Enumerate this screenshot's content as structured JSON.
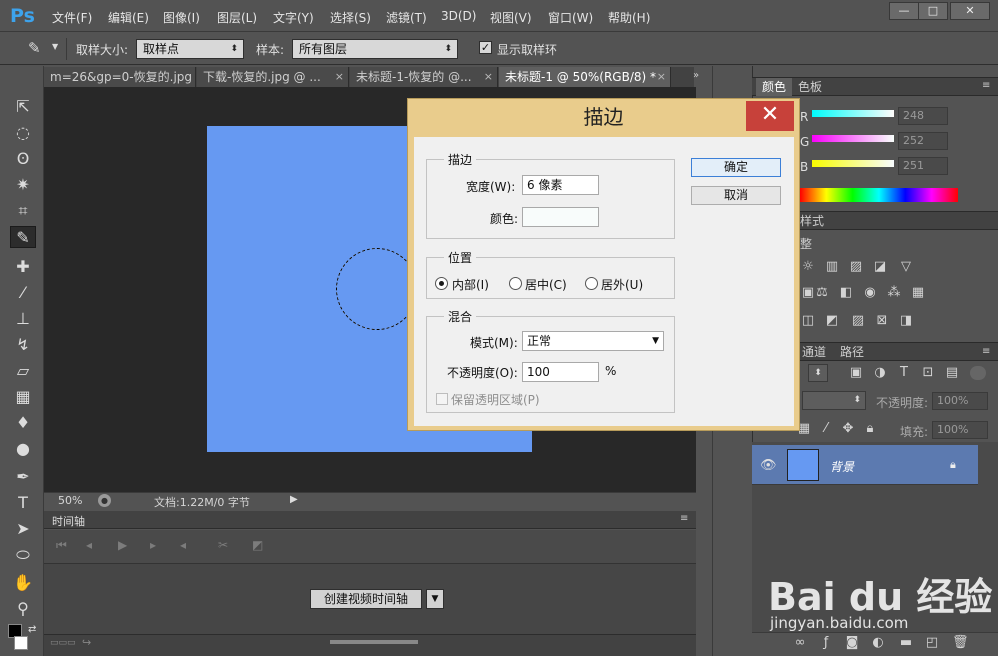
{
  "app": {
    "logo": "Ps"
  },
  "menu": [
    "文件(F)",
    "编辑(E)",
    "图像(I)",
    "图层(L)",
    "文字(Y)",
    "选择(S)",
    "滤镜(T)",
    "3D(D)",
    "视图(V)",
    "窗口(W)",
    "帮助(H)"
  ],
  "window_controls": {
    "minimize": "—",
    "maximize": "□",
    "close": "✕"
  },
  "options": {
    "sample_size_label": "取样大小:",
    "sample_size_value": "取样点",
    "sample_label": "样本:",
    "sample_value": "所有图层",
    "show_ring_label": "显示取样环",
    "show_ring_checked": true
  },
  "tabs": [
    {
      "label": "m=26&gp=0-恢复的.jpg",
      "close": "×"
    },
    {
      "label": "下载-恢复的.jpg @ ...",
      "close": "×"
    },
    {
      "label": "未标题-1-恢复的 @...",
      "close": "×"
    },
    {
      "label": "未标题-1 @ 50%(RGB/8) *",
      "close": "×",
      "active": true
    }
  ],
  "status": {
    "zoom": "50%",
    "doc": "文档:1.22M/0 字节"
  },
  "timeline": {
    "title": "时间轴",
    "create_button": "创建视频时间轴"
  },
  "color_panel": {
    "tabs": [
      "颜色",
      "色板"
    ],
    "r": "248",
    "g": "252",
    "b": "251",
    "r_label": "R",
    "g_label": "G",
    "b_label": "B"
  },
  "adjust_panel": {
    "tab": "样式",
    "sub": "整"
  },
  "layers_panel": {
    "tabs": [
      "通道",
      "路径"
    ],
    "opacity_label": "不透明度:",
    "opacity_value": "100%",
    "fill_label": "填充:",
    "fill_value": "100%",
    "layer_name": "背景"
  },
  "dialog": {
    "title": "描边",
    "close": "✕",
    "stroke_group": "描边",
    "width_label": "宽度(W):",
    "width_value": "6 像素",
    "color_label": "颜色:",
    "color_value": "#f8fcfb",
    "position_group": "位置",
    "pos_inside": "内部(I)",
    "pos_center": "居中(C)",
    "pos_outside": "居外(U)",
    "blend_group": "混合",
    "mode_label": "模式(M):",
    "mode_value": "正常",
    "opacity_label": "不透明度(O):",
    "opacity_value": "100",
    "opacity_unit": "%",
    "preserve_label": "保留透明区域(P)",
    "ok": "确定",
    "cancel": "取消"
  },
  "watermark": {
    "brand": "Bai du 经验",
    "url": "jingyan.baidu.com"
  }
}
